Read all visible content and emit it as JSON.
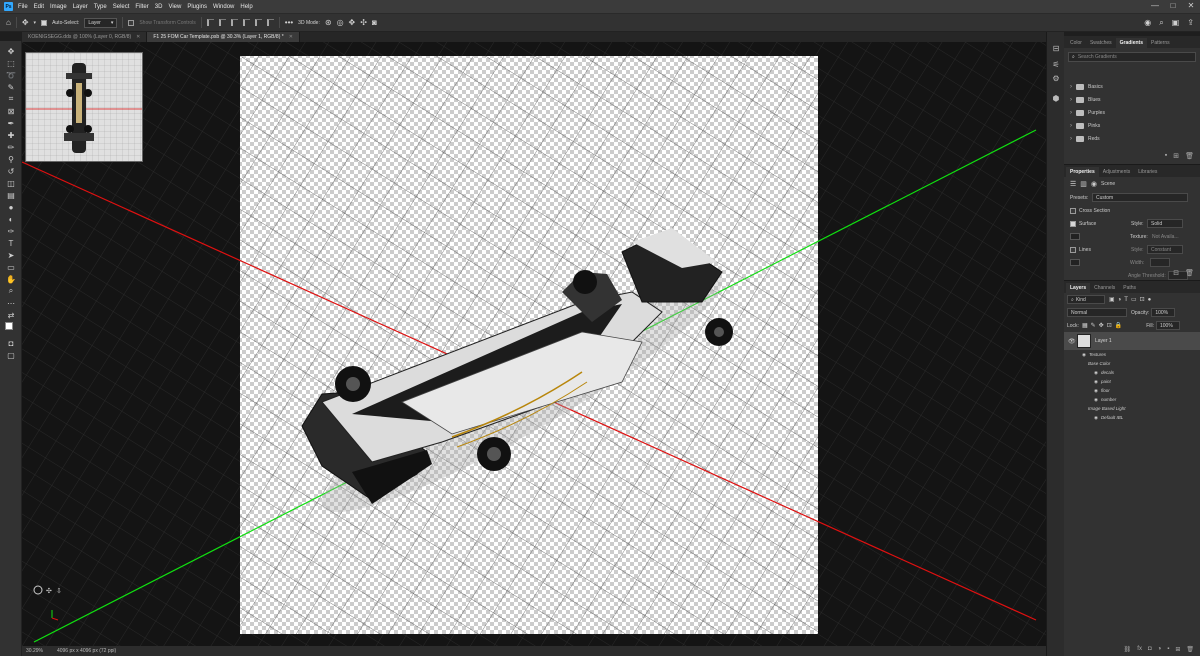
{
  "app": {
    "logo": "Ps"
  },
  "menu": [
    "File",
    "Edit",
    "Image",
    "Layer",
    "Type",
    "Select",
    "Filter",
    "3D",
    "View",
    "Plugins",
    "Window",
    "Help"
  ],
  "window_controls": [
    "—",
    "□",
    "✕"
  ],
  "options_bar": {
    "auto_select_label": "Auto-Select:",
    "auto_select_value": "Layer",
    "transform_controls_label": "Show Transform Controls",
    "mode_3d_label": "3D Mode:"
  },
  "tabs": [
    {
      "label": "KOENIGSEGG.dds @ 100% (Layer 0, RGB/8)",
      "active": false
    },
    {
      "label": "F1 25 FOM Car Template.psb @ 30.3% (Layer 1, RGB/8) *",
      "active": true
    }
  ],
  "status": {
    "zoom": "30.29%",
    "doc_info": "4096 px x 4096 px (72 ppi)"
  },
  "colors": {
    "red_axis": "#e01010",
    "green_axis": "#10e010",
    "accent": "#31a8ff"
  },
  "swatch_panel": {
    "tabs": [
      "Color",
      "Swatches",
      "Gradients",
      "Patterns"
    ],
    "active_tab": "Gradients",
    "search_placeholder": "Search Gradients",
    "groups": [
      "Basics",
      "Blues",
      "Purples",
      "Pinks",
      "Reds"
    ]
  },
  "properties_panel": {
    "tabs": [
      "Properties",
      "Adjustments",
      "Libraries"
    ],
    "scene_label": "Scene",
    "presets_label": "Presets:",
    "presets_value": "Custom",
    "cross_section": "Cross Section",
    "surface": "Surface",
    "style_label": "Style:",
    "style_value": "Solid",
    "texture_label": "Texture:",
    "texture_value": "Not Availa...",
    "lines": "Lines",
    "lines_style_value": "Constant",
    "width_label": "Width:",
    "angle_label": "Angle Threshold:"
  },
  "layers_panel": {
    "tabs": [
      "Layers",
      "Channels",
      "Paths"
    ],
    "kind_label": "Kind",
    "blend_mode": "Normal",
    "opacity_label": "Opacity:",
    "opacity_value": "100%",
    "lock_label": "Lock:",
    "fill_label": "Fill:",
    "fill_value": "100%",
    "layer_name": "Layer 1",
    "sublayers": [
      {
        "name": "Textures",
        "indent": 1,
        "eye": true
      },
      {
        "name": "Base Color",
        "indent": 2,
        "eye": false
      },
      {
        "name": "decals",
        "indent": 3,
        "eye": true
      },
      {
        "name": "paint",
        "indent": 3,
        "eye": true
      },
      {
        "name": "floor",
        "indent": 3,
        "eye": true
      },
      {
        "name": "number",
        "indent": 3,
        "eye": true
      },
      {
        "name": "Image Based Light",
        "indent": 2,
        "eye": false
      },
      {
        "name": "Default IBL",
        "indent": 3,
        "eye": true
      }
    ]
  }
}
